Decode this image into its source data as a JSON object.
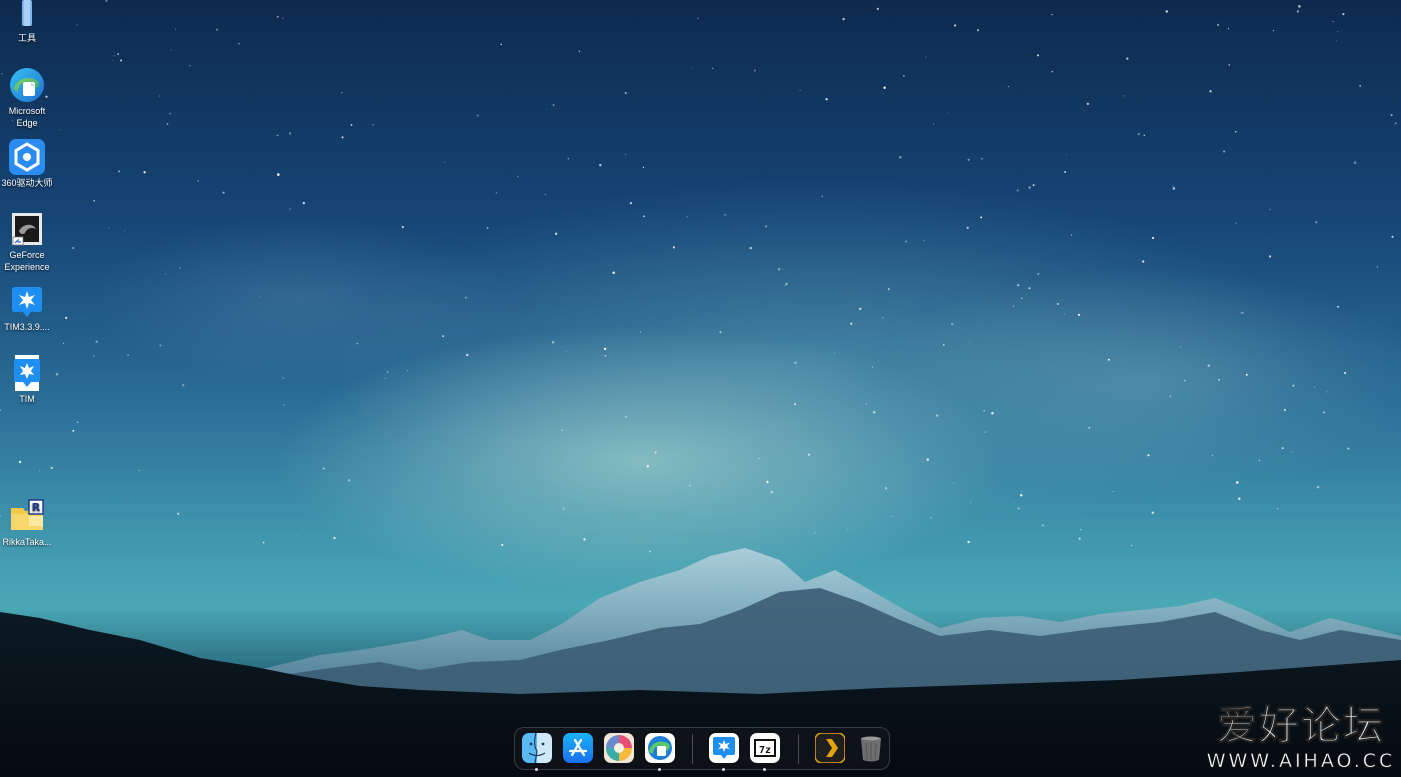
{
  "desktop_icons": [
    {
      "label": "工具",
      "icon": "folder-icon"
    },
    {
      "label": "Microsoft Edge",
      "icon": "edge-icon"
    },
    {
      "label": "360驱动大师",
      "icon": "360-driver-icon"
    },
    {
      "label": "GeForce Experience",
      "icon": "geforce-icon"
    },
    {
      "label": "TIM3.3.9....",
      "icon": "tim-icon"
    },
    {
      "label": "TIM",
      "icon": "tim-icon"
    },
    {
      "label": "RikkaTaka...",
      "icon": "rikka-icon"
    }
  ],
  "dock": {
    "items": [
      {
        "name": "finder",
        "icon": "finder-icon",
        "running": true
      },
      {
        "name": "app-store",
        "icon": "app-store-icon",
        "running": false
      },
      {
        "name": "colorful-app",
        "icon": "color-app-icon",
        "running": false
      },
      {
        "name": "edge",
        "icon": "edge-icon",
        "running": true
      },
      {
        "name": "tim",
        "icon": "tim-icon",
        "running": true
      },
      {
        "name": "7zip",
        "icon": "7zip-icon",
        "running": true
      },
      {
        "name": "plex",
        "icon": "plex-icon",
        "running": false
      },
      {
        "name": "trash",
        "icon": "trash-icon",
        "running": false
      }
    ],
    "seven_zip_text": "7z"
  },
  "watermark": {
    "title": "爱好论坛",
    "url": "WWW.AIHAO.CC"
  },
  "colors": {
    "sky_top": "#0d2a4e",
    "sky_mid": "#2b6e97",
    "horizon": "#4aa8b5",
    "tim_blue": "#1e8ef0",
    "plex_orange": "#e5a00d"
  }
}
